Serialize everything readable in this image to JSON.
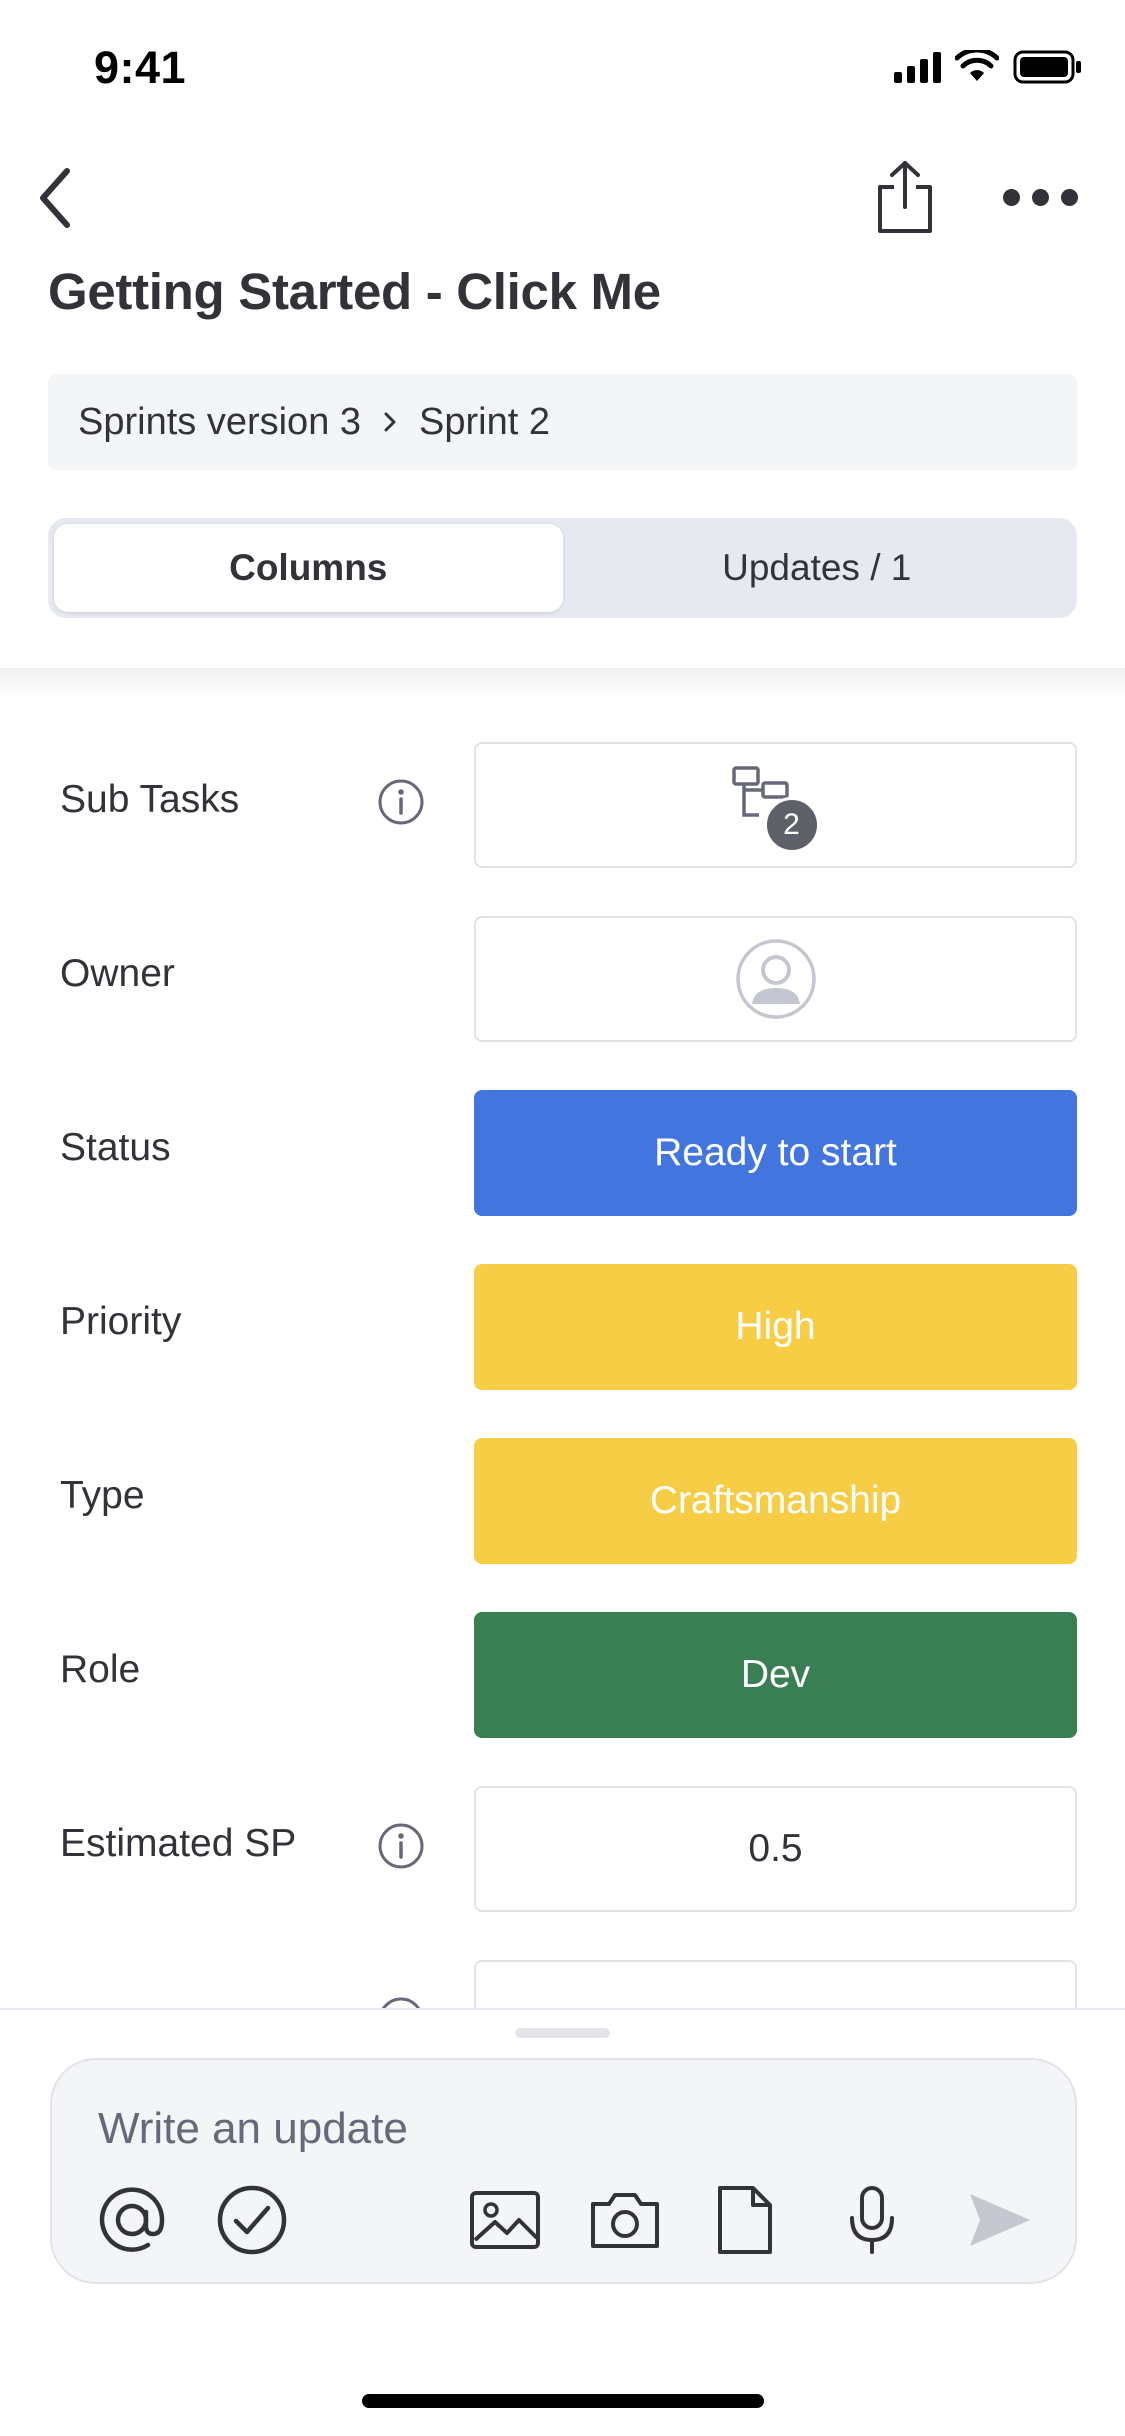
{
  "status_bar": {
    "time": "9:41"
  },
  "header": {
    "title": "Getting Started - Click Me",
    "breadcrumb": {
      "parent": "Sprints version 3",
      "current": "Sprint 2"
    },
    "tabs": [
      {
        "label": "Columns",
        "active": true
      },
      {
        "label": "Updates / 1",
        "active": false
      }
    ]
  },
  "columns": {
    "subtasks": {
      "label": "Sub Tasks",
      "count": "2"
    },
    "owner": {
      "label": "Owner"
    },
    "status": {
      "label": "Status",
      "value": "Ready to start",
      "color": "#4375df"
    },
    "priority": {
      "label": "Priority",
      "value": "High",
      "color": "#f6cd45"
    },
    "type": {
      "label": "Type",
      "value": "Craftsmanship",
      "color": "#f6cd45"
    },
    "role": {
      "label": "Role",
      "value": "Dev",
      "color": "#3a7f54"
    },
    "estimated_sp": {
      "label": "Estimated SP",
      "value": "0.5"
    }
  },
  "composer": {
    "placeholder": "Write an update",
    "tools": [
      "at-mention-icon",
      "checkmark-circle-icon",
      "image-icon",
      "camera-icon",
      "file-icon",
      "microphone-icon",
      "send-icon"
    ]
  }
}
